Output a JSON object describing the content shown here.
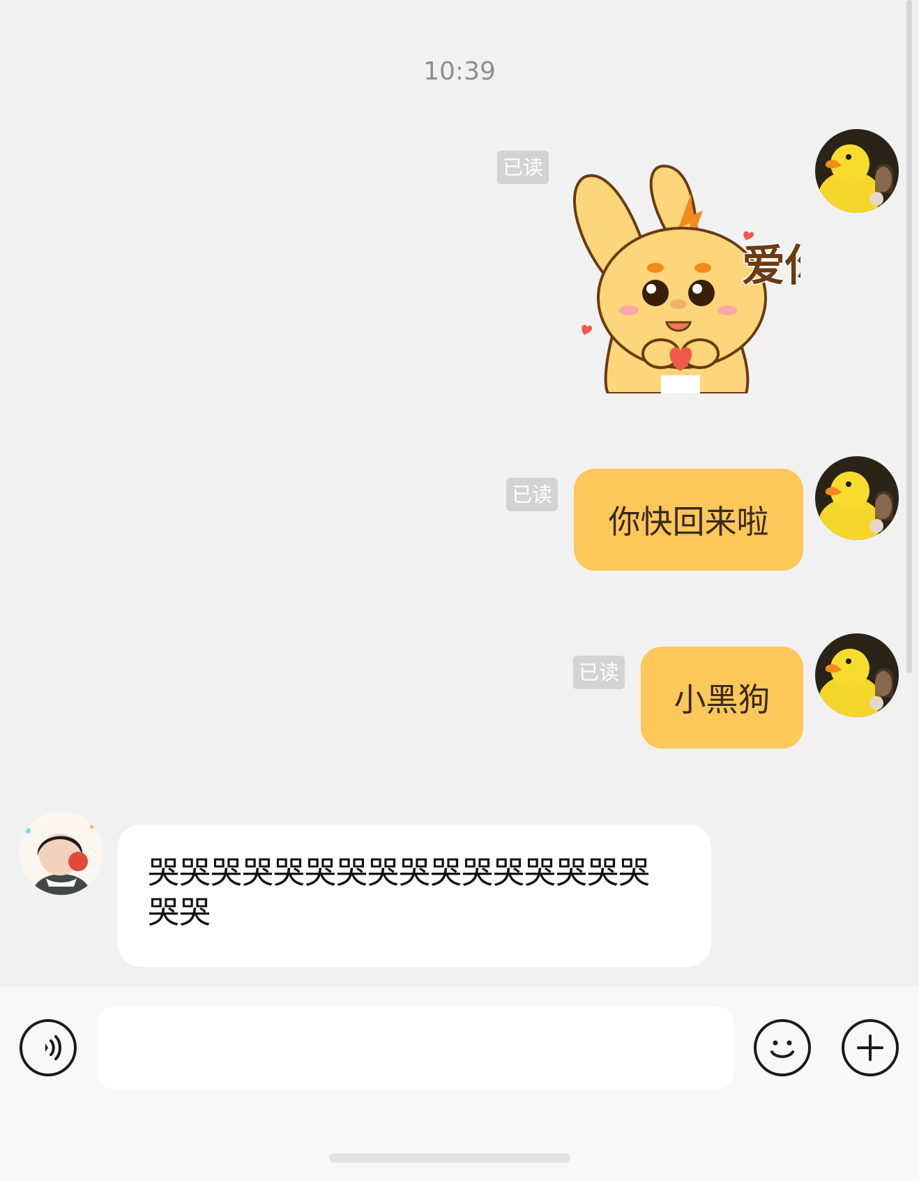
{
  "chat": {
    "timestamp": "10:39",
    "read_label": "已读",
    "messages": [
      {
        "sender": "me",
        "type": "sticker",
        "sticker_text": "爱你",
        "status": "已读"
      },
      {
        "sender": "me",
        "type": "text",
        "text": "你快回来啦",
        "status": "已读"
      },
      {
        "sender": "me",
        "type": "text",
        "text": "小黑狗",
        "status": "已读"
      },
      {
        "sender": "other",
        "type": "text",
        "text": "哭哭哭哭哭哭哭哭哭哭哭哭哭哭哭哭哭哭"
      }
    ]
  },
  "input_bar": {
    "voice_icon": "voice-icon",
    "emoji_icon": "emoji-icon",
    "plus_icon": "plus-icon",
    "input_value": ""
  },
  "colors": {
    "background": "#f1f1f1",
    "outgoing_bubble": "#fdc75a",
    "incoming_bubble": "#ffffff",
    "read_tag": "#d3d3d3"
  }
}
